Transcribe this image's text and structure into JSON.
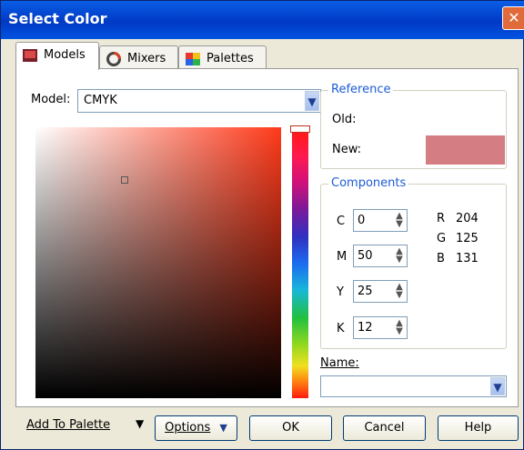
{
  "window": {
    "title": "Select Color",
    "close_icon": "close-icon"
  },
  "tabs": [
    {
      "label": "Models",
      "icon": "models-icon",
      "active": true
    },
    {
      "label": "Mixers",
      "icon": "mixers-icon"
    },
    {
      "label": "Palettes",
      "icon": "palettes-icon"
    }
  ],
  "model": {
    "label": "Model:",
    "value": "CMYK"
  },
  "reference": {
    "title": "Reference",
    "old_label": "Old:",
    "new_label": "New:",
    "new_color": "#d47d83"
  },
  "components": {
    "title": "Components",
    "cmyk": [
      {
        "label": "C",
        "value": "0"
      },
      {
        "label": "M",
        "value": "50"
      },
      {
        "label": "Y",
        "value": "25"
      },
      {
        "label": "K",
        "value": "12"
      }
    ],
    "rgb": [
      {
        "label": "R",
        "value": "204"
      },
      {
        "label": "G",
        "value": "125"
      },
      {
        "label": "B",
        "value": "131"
      }
    ]
  },
  "name": {
    "label": "Name:",
    "value": ""
  },
  "buttons": {
    "add_to_palette": "Add To Palette",
    "options": "Options",
    "ok": "OK",
    "cancel": "Cancel",
    "help": "Help"
  }
}
